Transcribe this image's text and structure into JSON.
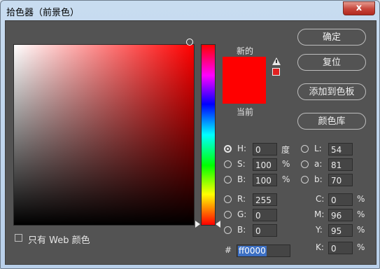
{
  "window": {
    "title": "拾色器（前景色）",
    "close_label": "x"
  },
  "preview": {
    "new_label": "新的",
    "current_label": "当前",
    "new_color": "#ff0000",
    "current_color": "#ff0000"
  },
  "buttons": {
    "ok": "确定",
    "reset": "复位",
    "add_swatch": "添加到色板",
    "color_library": "颜色库"
  },
  "fields": {
    "H": {
      "label": "H:",
      "value": "0",
      "unit": "度",
      "selected": true
    },
    "S": {
      "label": "S:",
      "value": "100",
      "unit": "%"
    },
    "Bri": {
      "label": "B:",
      "value": "100",
      "unit": "%"
    },
    "R": {
      "label": "R:",
      "value": "255"
    },
    "G": {
      "label": "G:",
      "value": "0"
    },
    "Blue": {
      "label": "B:",
      "value": "0"
    },
    "L": {
      "label": "L:",
      "value": "54"
    },
    "a": {
      "label": "a:",
      "value": "81"
    },
    "b": {
      "label": "b:",
      "value": "70"
    },
    "C": {
      "label": "C:",
      "value": "0",
      "unit": "%"
    },
    "M": {
      "label": "M:",
      "value": "96",
      "unit": "%"
    },
    "Y": {
      "label": "Y:",
      "value": "95",
      "unit": "%"
    },
    "K": {
      "label": "K:",
      "value": "0",
      "unit": "%"
    }
  },
  "hex": {
    "label": "#",
    "value": "ff0000"
  },
  "web_only": {
    "label": "只有 Web 颜色",
    "checked": false
  },
  "icons": {
    "gamut_warning": "warning-triangle-icon",
    "close": "close-icon"
  },
  "colors": {
    "accent_selection": "#3b6fc4",
    "dialog_bg": "#535353"
  }
}
